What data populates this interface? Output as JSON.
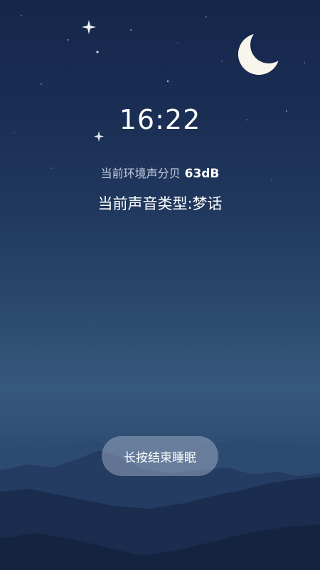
{
  "clock": {
    "time": "16:22"
  },
  "ambient": {
    "label": "当前环境声分贝",
    "value": "63dB"
  },
  "sound_type": {
    "text": "当前声音类型:梦话"
  },
  "end_button": {
    "label": "长按结束睡眠"
  },
  "icons": {
    "moon": "crescent-moon-icon",
    "stars": "star-icon"
  },
  "colors": {
    "sky_top": "#15264a",
    "sky_horizon": "#37597d",
    "mountain_near": "#142440",
    "button_bg": "#b9c4d6"
  }
}
